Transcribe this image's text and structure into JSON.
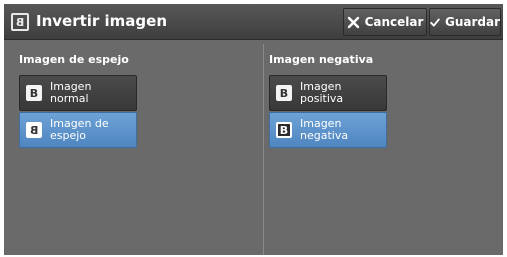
{
  "header": {
    "title": "Invertir imagen",
    "title_icon_glyph": "B",
    "cancel_label": "Cancelar",
    "save_label": "Guardar"
  },
  "mirror_section": {
    "label": "Imagen de espejo",
    "options": [
      {
        "label": "Imagen normal",
        "icon_glyph": "B",
        "selected": false
      },
      {
        "label": "Imagen de espejo",
        "icon_glyph": "B",
        "selected": true
      }
    ]
  },
  "negative_section": {
    "label": "Imagen negativa",
    "options": [
      {
        "label": "Imagen positiva",
        "icon_glyph": "B",
        "selected": false
      },
      {
        "label": "Imagen negativa",
        "icon_glyph": "B",
        "selected": true
      }
    ]
  },
  "colors": {
    "selected": "#5b93cb",
    "panel": "#6a6a6a",
    "header": "#4a4a4a"
  }
}
